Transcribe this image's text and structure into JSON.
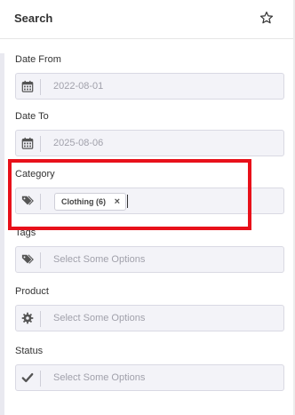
{
  "header": {
    "title": "Search",
    "star_icon": "star-icon"
  },
  "fields": {
    "date_from": {
      "label": "Date From",
      "value": "2022-08-01",
      "icon": "calendar-icon"
    },
    "date_to": {
      "label": "Date To",
      "value": "2025-08-06",
      "icon": "calendar-icon"
    },
    "category": {
      "label": "Category",
      "chip": "Clothing (6)",
      "remove": "×",
      "icon": "tags-icon"
    },
    "tags": {
      "label": "Tags",
      "placeholder": "Select Some Options",
      "icon": "tags-icon"
    },
    "product": {
      "label": "Product",
      "placeholder": "Select Some Options",
      "icon": "gear-icon"
    },
    "status": {
      "label": "Status",
      "placeholder": "Select Some Options",
      "icon": "check-icon"
    }
  },
  "colors": {
    "highlight": "#e8101a",
    "field_bg": "#f3f3f8"
  }
}
